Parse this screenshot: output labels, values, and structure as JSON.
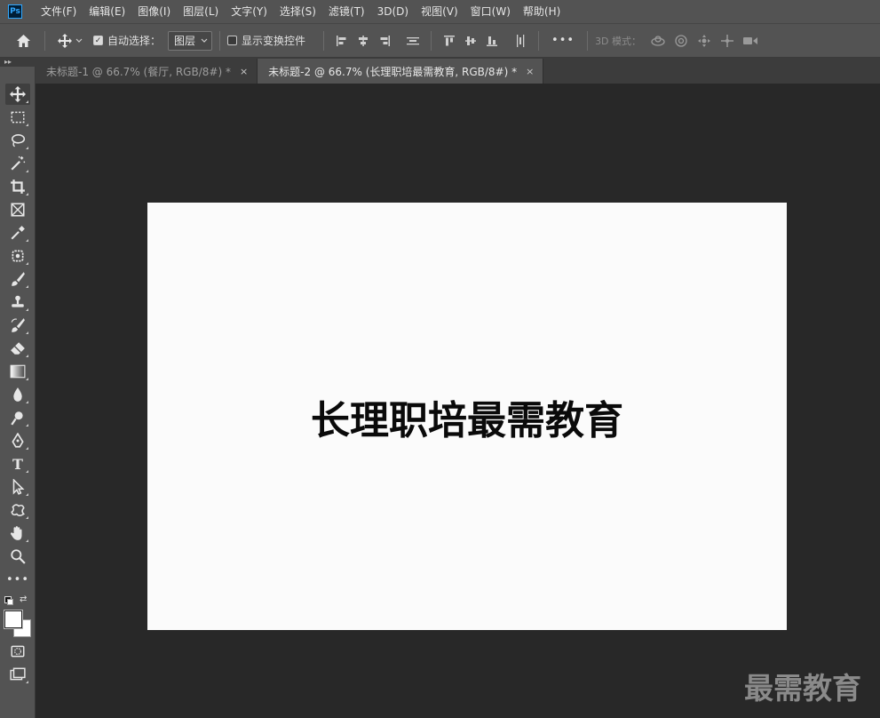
{
  "app": {
    "logo_text": "Ps"
  },
  "menu": [
    "文件(F)",
    "编辑(E)",
    "图像(I)",
    "图层(L)",
    "文字(Y)",
    "选择(S)",
    "滤镜(T)",
    "3D(D)",
    "视图(V)",
    "窗口(W)",
    "帮助(H)"
  ],
  "options": {
    "auto_select_label": "自动选择：",
    "auto_select_checked": true,
    "auto_select_value": "图层",
    "show_transform_label": "显示变换控件",
    "more_label": "•••",
    "mode_3d_label": "3D 模式："
  },
  "tabs": [
    {
      "title": "未标题-1 @ 66.7% (餐厅, RGB/8#) *",
      "active": false,
      "close": "×"
    },
    {
      "title": "未标题-2 @ 66.7% (长理职培最需教育, RGB/8#) *",
      "active": true,
      "close": "×"
    }
  ],
  "toolbar": {
    "more_label": "•••"
  },
  "canvas": {
    "text": "长理职培最需教育",
    "background": "#fbfbfb"
  },
  "watermark": "最需教育",
  "colors": {
    "menubar": "#535353",
    "workspace": "#282828",
    "accent": "#31a8ff"
  }
}
